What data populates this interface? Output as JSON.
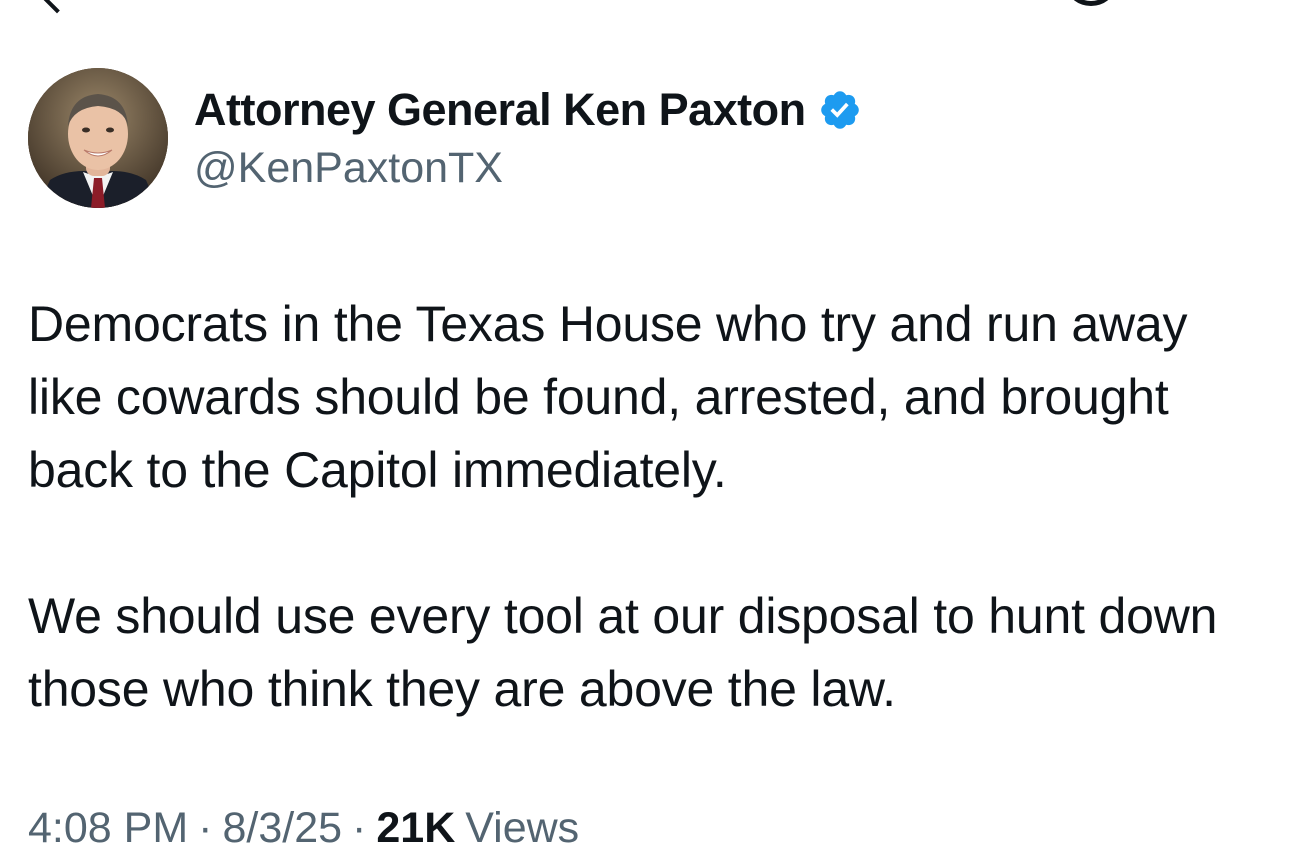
{
  "author": {
    "display_name": "Attorney General Ken Paxton",
    "handle": "@KenPaxtonTX",
    "verified": true,
    "badge_color": "#1d9bf0"
  },
  "tweet": {
    "paragraphs": [
      "Democrats in the Texas House who try and run away like cowards should be found, arrested, and brought back to the Capitol immediately.",
      "We should use every tool at our disposal to hunt down those who think they are above the law."
    ]
  },
  "meta": {
    "time": "4:08 PM",
    "separator": "·",
    "date": "8/3/25",
    "views_count": "21K",
    "views_label": "Views"
  },
  "colors": {
    "text_primary": "#0f1419",
    "text_secondary": "#536471",
    "background": "#ffffff"
  },
  "icons": {
    "back": "back-arrow-icon",
    "grok": "grok-icon",
    "verified": "verified-badge-icon"
  }
}
